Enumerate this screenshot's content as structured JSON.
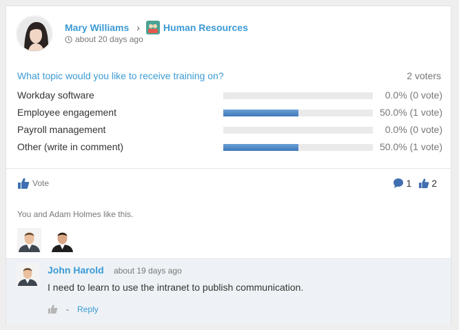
{
  "post": {
    "author": "Mary Williams",
    "group": "Human Resources",
    "time": "about 20 days ago"
  },
  "poll": {
    "question": "What topic would you like to receive training on?",
    "voters": "2 voters",
    "options": [
      {
        "label": "Workday software",
        "percent": 0,
        "result": "0.0% (0 vote)"
      },
      {
        "label": "Employee engagement",
        "percent": 50,
        "result": "50.0% (1 vote)"
      },
      {
        "label": "Payroll management",
        "percent": 0,
        "result": "0.0% (0 vote)"
      },
      {
        "label": "Other (write in comment)",
        "percent": 50,
        "result": "50.0% (1 vote)"
      }
    ]
  },
  "actions": {
    "vote_label": "Vote",
    "comment_count": "1",
    "like_count": "2"
  },
  "likes": {
    "text": "You and Adam Holmes like this."
  },
  "comment": {
    "author": "John Harold",
    "time": "about 19 days ago",
    "body": "I need to learn to use the intranet to publish communication.",
    "dash": "-",
    "reply_label": "Reply"
  },
  "colors": {
    "link": "#3a9ad4",
    "bar_fill": "#4a84c4",
    "bar_track": "#eaeaea",
    "comment_bg": "#eef2f6"
  },
  "icons": {
    "clock": "clock-icon",
    "thumb": "thumbs-up-icon",
    "comment": "comment-bubble-icon",
    "group": "group-avatar-icon"
  }
}
